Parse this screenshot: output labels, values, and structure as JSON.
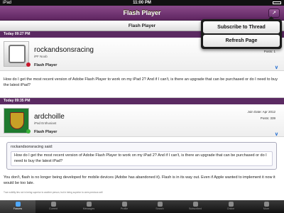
{
  "status": {
    "carrier": "iPad",
    "time": "11:00 PM"
  },
  "nav": {
    "title": "Flash Player",
    "action_icon": "share-icon"
  },
  "subheader": {
    "title": "Flash Player"
  },
  "popover": {
    "items": [
      "Subscribe to Thread",
      "Refresh Page"
    ]
  },
  "posts": [
    {
      "date": "Today 09:27 PM",
      "username": "rockandsonsracing",
      "rank": "iPF Noob",
      "device": "Flash Player",
      "posts": "Posts: 1",
      "status_color": "#c8182c",
      "body": "How do I get the most recent version of Adobe Flash Player to work on my iPad 2?  And if I can't, is there an upgrade that can be purchased or do I need to buy the latest iPad?"
    },
    {
      "date": "Today 09:35 PM",
      "username": "ardchoille",
      "rank": "iPad Enthusiast",
      "device": "Flash Player",
      "joined": "Join Date: Apr 2012",
      "posts": "Posts: 339",
      "status_color": "#3bb33b",
      "quote_author": "rockandsonsracing said:",
      "quote_text": "How do I get the most recent version of Adobe Flash Player to work on my iPad 2?  And if I can't, is there an upgrade that can be purchased or do I need to buy the latest iPad?",
      "body": "You don't, flash is no longer being developed for mobile devices (Adobe has abandoned it). Flash is in its way out. Even if Apple wanted to implement it now it would be too late.",
      "signature": "True nobility lies not in being superior to another person, but in being superior to ones previous self."
    }
  ],
  "tabs": [
    {
      "label": "Forums",
      "icon": "forums-icon",
      "active": true
    },
    {
      "label": "Current",
      "icon": "current-icon"
    },
    {
      "label": "Messages",
      "icon": "messages-icon"
    },
    {
      "label": "Profile",
      "icon": "profile-icon"
    },
    {
      "label": "Search",
      "icon": "search-icon"
    },
    {
      "label": "Subscribed",
      "icon": "subscribed-icon"
    },
    {
      "label": "Online",
      "icon": "online-icon"
    },
    {
      "label": "More",
      "icon": "more-icon"
    }
  ]
}
